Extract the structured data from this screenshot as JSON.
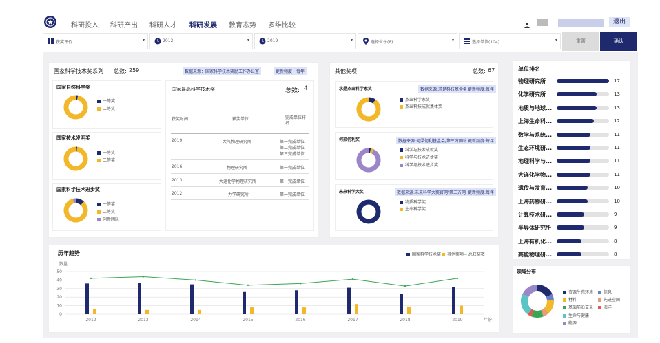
{
  "nav": {
    "items": [
      "科研投入",
      "科研产出",
      "科研人才",
      "科研发展",
      "教育态势",
      "多维比较"
    ],
    "active": "科研发展",
    "logout": "退出"
  },
  "filters": {
    "type": "获奖评价",
    "start_year": "2012",
    "end_year": "2019",
    "region": "选择省份(8)",
    "unit": "选择单位(104)",
    "reset": "重置",
    "confirm": "确认"
  },
  "national": {
    "title": "国家科学技术奖系列",
    "total_label": "总数:",
    "total": "259",
    "source_tag": "数据来源：国家科学技术奖励工作办公室",
    "freq_tag": "更新频度：每年",
    "natural": {
      "title": "国家自然科学奖",
      "legend": [
        "一等奖",
        "二等奖"
      ]
    },
    "invention": {
      "title": "国家技术发明奖",
      "legend": [
        "一等奖",
        "二等奖"
      ]
    },
    "progress": {
      "title": "国家科学技术进步奖",
      "legend": [
        "一等奖",
        "二等奖",
        "创新团队"
      ]
    },
    "top": {
      "title": "国家最高科学技术奖",
      "total_label": "总数:",
      "total": "4",
      "headers": [
        "获奖时间",
        "获奖单位",
        "完成单位排名"
      ],
      "rows": [
        {
          "year": "2019",
          "unit": "大气物理研究所",
          "rank": "第一完成单位",
          "rank2": "第二完成单位",
          "rank3": "第三完成单位"
        },
        {
          "year": "2016",
          "unit": "物理研究所",
          "rank": "第一完成单位"
        },
        {
          "year": "2013",
          "unit": "大连化学物理研究所",
          "rank": "第一完成单位"
        },
        {
          "year": "2012",
          "unit": "力学研究所",
          "rank": "第一完成单位"
        }
      ]
    }
  },
  "other": {
    "title": "其他奖项",
    "total_label": "总数:",
    "total": "67",
    "qiushi": {
      "title": "求是杰出科学家奖",
      "source": "数据来源:求是科技基金会",
      "freq": "更新频度:每年",
      "legend": [
        "杰出科学家奖",
        "杰出科技成就集体奖"
      ]
    },
    "helian": {
      "title": "何梁何利奖",
      "source": "数据来源:何梁何利基金会/第三方网站",
      "freq": "更新频度:每年",
      "legend": [
        "科学与技术成就奖",
        "科学与技术进步奖",
        "科学与技术进步奖"
      ]
    },
    "future": {
      "title": "未来科学大奖",
      "source": "数据来源:未来科学大奖官网/第三方网站",
      "freq": "更新频度:每年",
      "legend": [
        "物质科学奖",
        "生命科学奖"
      ]
    }
  },
  "ranking": {
    "title": "单位排名",
    "items": [
      {
        "name": "物理研究所",
        "value": 17
      },
      {
        "name": "化学研究所",
        "value": 13
      },
      {
        "name": "地质与地球...",
        "value": 13
      },
      {
        "name": "上海生命科...",
        "value": 12
      },
      {
        "name": "数学与系统...",
        "value": 11
      },
      {
        "name": "生态环境研...",
        "value": 11
      },
      {
        "name": "地理科学与...",
        "value": 11
      },
      {
        "name": "大连化学物...",
        "value": 11
      },
      {
        "name": "遗传与发育...",
        "value": 10
      },
      {
        "name": "上海药物研...",
        "value": 10
      },
      {
        "name": "计算技术研...",
        "value": 9
      },
      {
        "name": "半导体研究所",
        "value": 9
      },
      {
        "name": "上海有机化...",
        "value": 8
      },
      {
        "name": "高能物理研...",
        "value": 8
      }
    ]
  },
  "field": {
    "title": "领域分布",
    "legend": [
      "资源生态环境",
      "信息",
      "材料",
      "先进空间",
      "基础前沿交叉",
      "海洋",
      "生命与健康",
      "能源"
    ],
    "colors": [
      "#1f2a6e",
      "#6b7fc8",
      "#f2b82a",
      "#e89b7a",
      "#3aa655",
      "#e05a4f",
      "#5bc4c4",
      "#9b87c8"
    ],
    "values": [
      18,
      6,
      14,
      6,
      12,
      4,
      22,
      18
    ]
  },
  "trend": {
    "title": "历年趋势",
    "legend": [
      "国家科学技术奖",
      "其他奖项",
      "总获奖数"
    ]
  },
  "colors": {
    "navy": "#1f2a6e",
    "gold": "#f2b82a",
    "purple": "#9b87c8",
    "green": "#3aa655"
  },
  "chart_data": [
    {
      "type": "bar",
      "title": "历年趋势",
      "ylabel": "数量",
      "xlabel": "年份",
      "ylim": [
        0,
        50
      ],
      "yticks": [
        0,
        10,
        20,
        30,
        40,
        50
      ],
      "categories": [
        "2012",
        "2013",
        "2014",
        "2015",
        "2016",
        "2017",
        "2018",
        "2019"
      ],
      "series": [
        {
          "name": "国家科学技术奖",
          "kind": "bar",
          "values": [
            36,
            37,
            35,
            26,
            28,
            31,
            24,
            32
          ]
        },
        {
          "name": "其他奖项",
          "kind": "bar",
          "values": [
            6,
            5,
            5,
            8,
            8,
            12,
            9,
            10
          ]
        },
        {
          "name": "总获奖数",
          "kind": "line",
          "values": [
            42,
            44,
            40,
            34,
            36,
            41,
            33,
            42
          ]
        }
      ]
    },
    {
      "type": "pie",
      "title": "国家自然科学奖",
      "labels": [
        "一等奖",
        "二等奖"
      ],
      "values": [
        3,
        97
      ],
      "colors": [
        "#1f2a6e",
        "#f2b82a"
      ]
    },
    {
      "type": "pie",
      "title": "国家技术发明奖",
      "labels": [
        "一等奖",
        "二等奖"
      ],
      "values": [
        2,
        98
      ],
      "colors": [
        "#1f2a6e",
        "#f2b82a"
      ]
    },
    {
      "type": "pie",
      "title": "国家科学技术进步奖",
      "labels": [
        "一等奖",
        "二等奖",
        "创新团队"
      ],
      "values": [
        12,
        84,
        4
      ],
      "colors": [
        "#1f2a6e",
        "#f2b82a",
        "#9b87c8"
      ]
    },
    {
      "type": "pie",
      "title": "求是杰出科学家奖",
      "labels": [
        "杰出科学家奖",
        "杰出科技成就集体奖"
      ],
      "values": [
        10,
        90
      ],
      "colors": [
        "#1f2a6e",
        "#f2b82a"
      ]
    },
    {
      "type": "pie",
      "title": "何梁何利奖",
      "labels": [
        "科学与技术成就奖",
        "科学与技术进步奖",
        "科学与技术进步奖"
      ],
      "values": [
        3,
        4,
        93
      ],
      "colors": [
        "#1f2a6e",
        "#f2b82a",
        "#9b87c8"
      ]
    },
    {
      "type": "pie",
      "title": "未来科学大奖",
      "labels": [
        "物质科学奖",
        "生命科学奖"
      ],
      "values": [
        100,
        0
      ],
      "colors": [
        "#1f2a6e",
        "#f2b82a"
      ]
    }
  ]
}
